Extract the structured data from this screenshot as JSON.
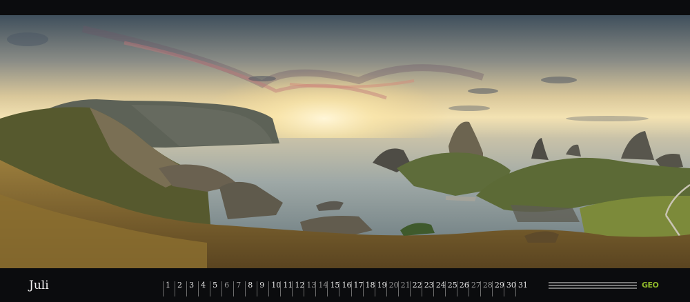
{
  "calendar": {
    "month": "Juli",
    "days": [
      {
        "day": "1"
      },
      {
        "day": "2"
      },
      {
        "day": "3"
      },
      {
        "day": "4"
      },
      {
        "day": "5"
      },
      {
        "day": "6",
        "weekend": true
      },
      {
        "day": "7",
        "weekend": true
      },
      {
        "day": "8"
      },
      {
        "day": "9"
      },
      {
        "day": "10"
      },
      {
        "day": "11"
      },
      {
        "day": "12"
      },
      {
        "day": "13",
        "weekend": true
      },
      {
        "day": "14",
        "weekend": true
      },
      {
        "day": "15"
      },
      {
        "day": "16"
      },
      {
        "day": "17"
      },
      {
        "day": "18"
      },
      {
        "day": "19"
      },
      {
        "day": "20",
        "weekend": true
      },
      {
        "day": "21",
        "weekend": true
      },
      {
        "day": "22"
      },
      {
        "day": "23"
      },
      {
        "day": "24"
      },
      {
        "day": "25"
      },
      {
        "day": "26"
      },
      {
        "day": "27",
        "weekend": true
      },
      {
        "day": "28",
        "weekend": true
      },
      {
        "day": "29"
      },
      {
        "day": "30"
      },
      {
        "day": "31"
      }
    ]
  },
  "branding": {
    "logo": "GEO",
    "logo_color": "#8fb82a"
  }
}
